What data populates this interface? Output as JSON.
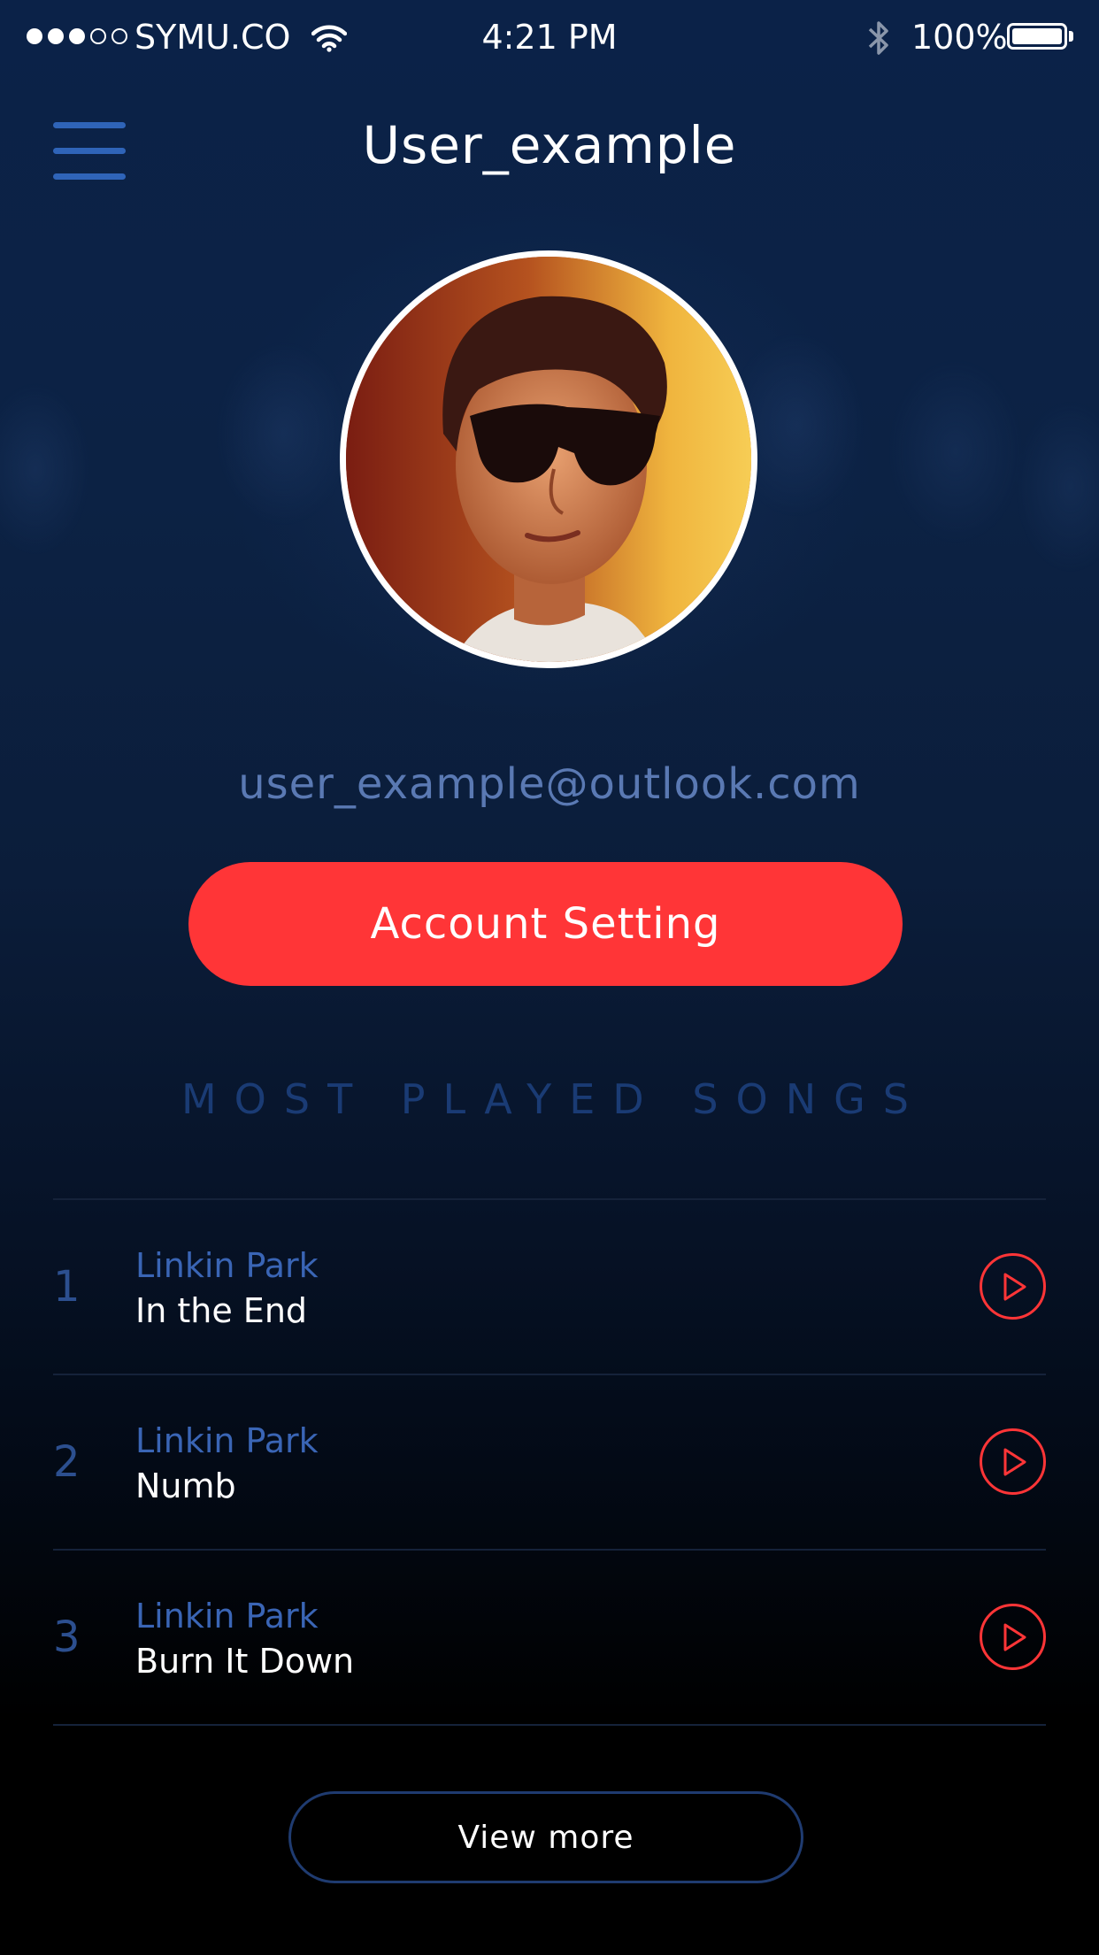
{
  "status_bar": {
    "carrier": "SYMU.CO",
    "time": "4:21 PM",
    "battery": "100%",
    "signal_bars_filled": 3,
    "signal_bars_total": 5,
    "battery_level": 1.0
  },
  "header": {
    "title": "User_example"
  },
  "profile": {
    "email": "user_example@outlook.com",
    "account_button_label": "Account Setting"
  },
  "section": {
    "title": "MOST PLAYED SONGS"
  },
  "songs": [
    {
      "rank": "1",
      "artist": "Linkin Park",
      "title": "In the End"
    },
    {
      "rank": "2",
      "artist": "Linkin Park",
      "title": "Numb"
    },
    {
      "rank": "3",
      "artist": "Linkin Park",
      "title": "Burn It Down"
    }
  ],
  "footer": {
    "view_more_label": "View more"
  },
  "colors": {
    "accent": "#ff3537",
    "blue_text": "#3a65b5",
    "email_text": "#5a79b3",
    "section_title": "#1a3b74"
  },
  "icons": {
    "menu": "hamburger-menu-icon",
    "wifi": "wifi-icon",
    "bluetooth": "bluetooth-icon",
    "battery": "battery-icon",
    "play": "play-icon"
  }
}
